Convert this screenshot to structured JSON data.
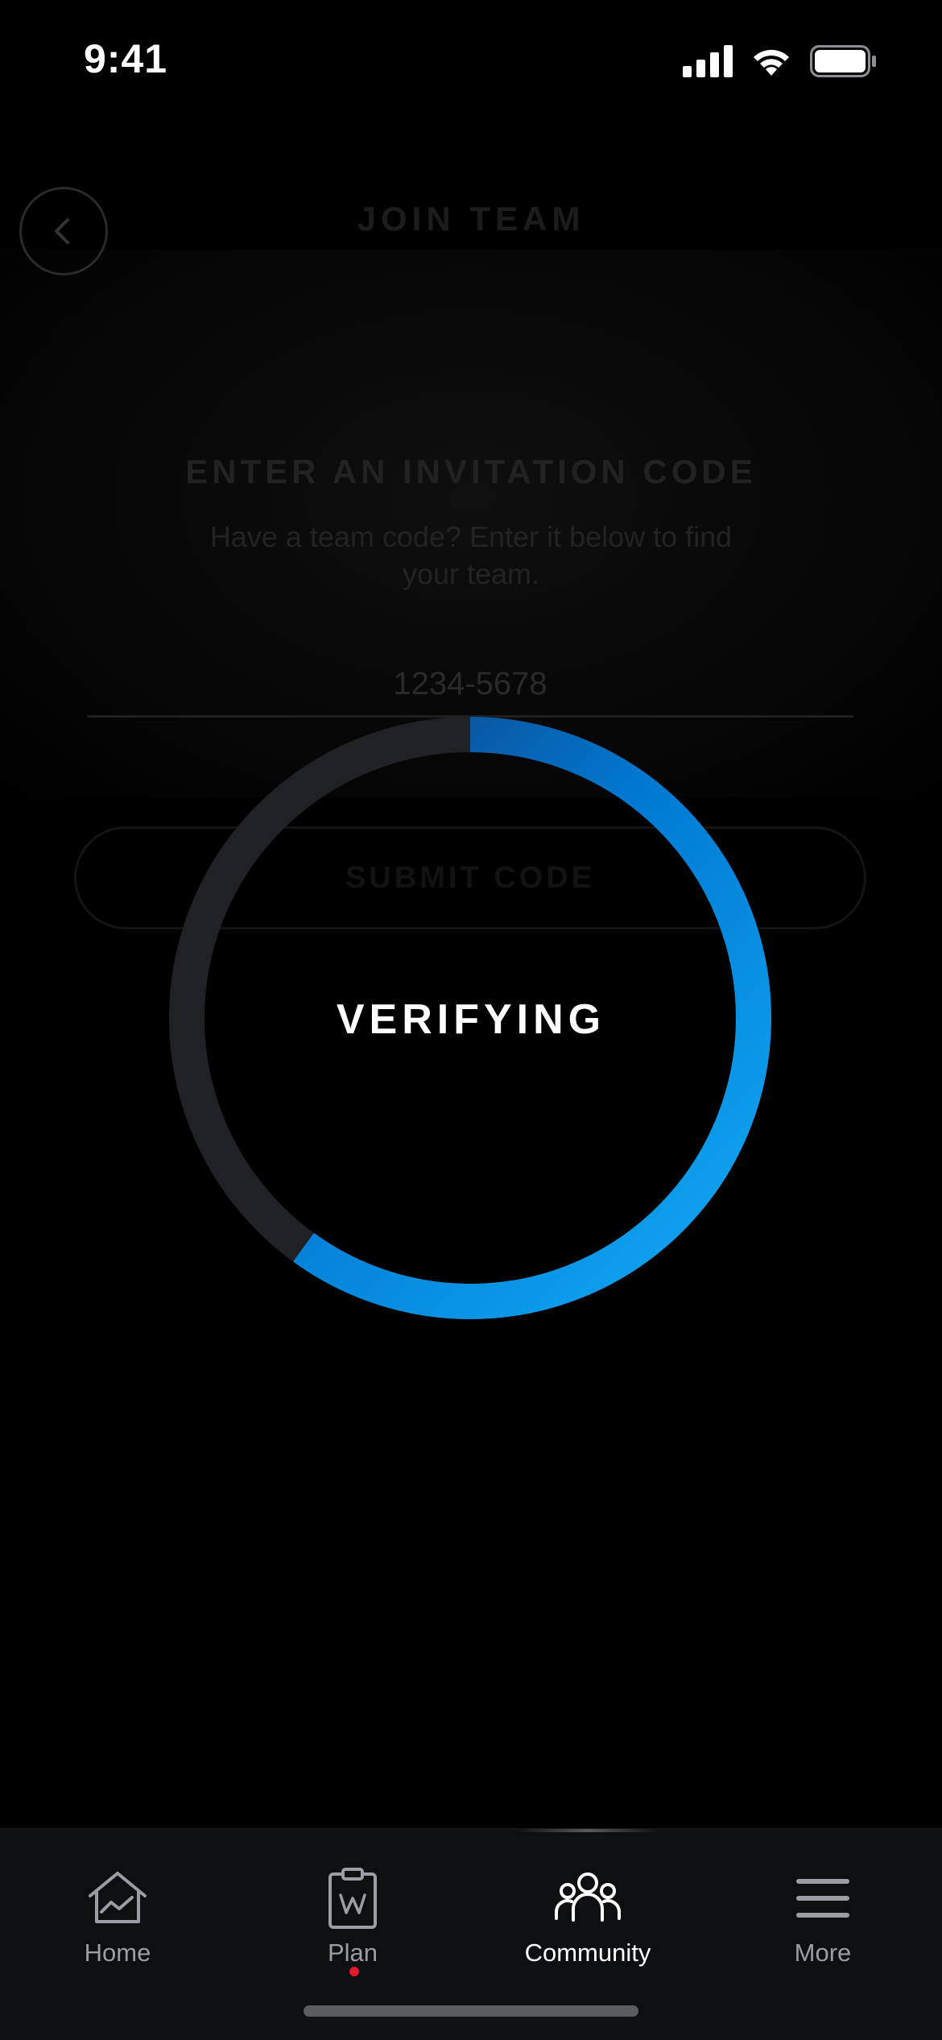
{
  "status_bar": {
    "time": "9:41",
    "icons": [
      "cellular-signal-icon",
      "wifi-icon",
      "battery-icon"
    ]
  },
  "background_screen": {
    "header_title": "JOIN TEAM",
    "back_icon": "chevron-left-icon",
    "invite_title": "ENTER AN INVITATION CODE",
    "invite_subtitle": "Have a team code? Enter it below to find your team.",
    "code_placeholder": "1234-5678",
    "submit_label": "SUBMIT CODE"
  },
  "verifying": {
    "label": "VERIFYING",
    "progress_fraction": 0.6,
    "colors": {
      "track": "#202124",
      "gradient_start": "#12a9f5",
      "gradient_end": "#15346e"
    }
  },
  "tab_bar": {
    "tabs": [
      {
        "label": "Home",
        "icon": "home-icon",
        "active": false
      },
      {
        "label": "Plan",
        "icon": "clipboard-plan-icon",
        "active": false,
        "badge": true
      },
      {
        "label": "Community",
        "icon": "people-group-icon",
        "active": true
      },
      {
        "label": "More",
        "icon": "menu-icon",
        "active": false
      }
    ],
    "badge_color": "#e0192d"
  }
}
